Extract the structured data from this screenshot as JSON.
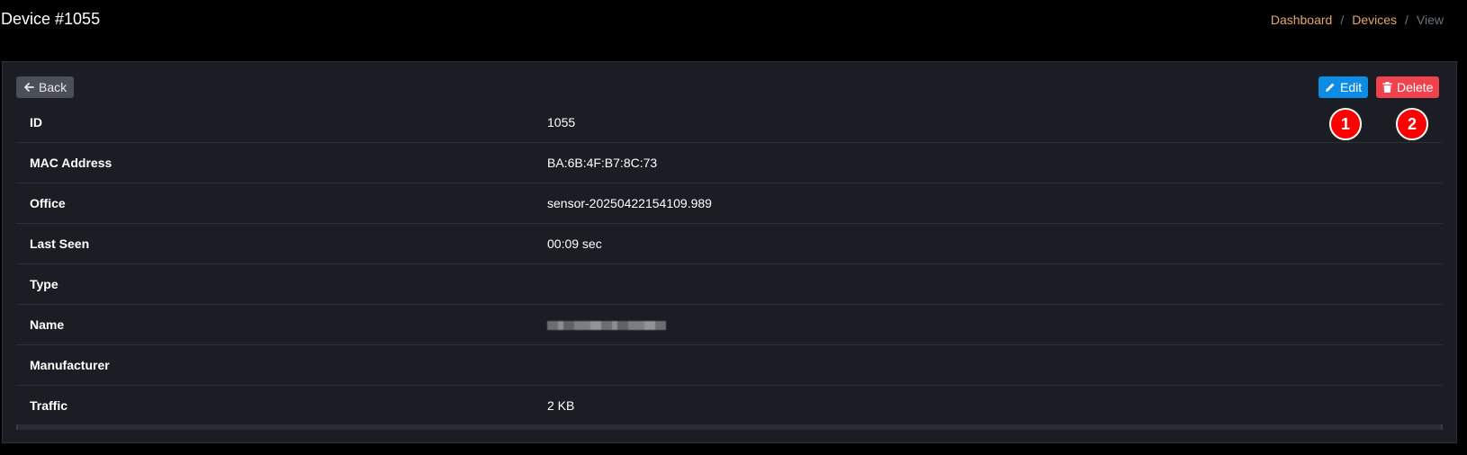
{
  "header": {
    "title": "Device #1055",
    "breadcrumb": {
      "dashboard": "Dashboard",
      "devices": "Devices",
      "current": "View",
      "separator": "/"
    }
  },
  "toolbar": {
    "back_label": "Back",
    "edit_label": "Edit",
    "delete_label": "Delete"
  },
  "markers": {
    "edit": "1",
    "delete": "2"
  },
  "details": {
    "rows": [
      {
        "label": "ID",
        "value": "1055"
      },
      {
        "label": "MAC Address",
        "value": "BA:6B:4F:B7:8C:73"
      },
      {
        "label": "Office",
        "value": "sensor-20250422154109.989"
      },
      {
        "label": "Last Seen",
        "value": "00:09 sec"
      },
      {
        "label": "Type",
        "value": ""
      },
      {
        "label": "Name",
        "value": ""
      },
      {
        "label": "Manufacturer",
        "value": ""
      },
      {
        "label": "Traffic",
        "value": "2 KB"
      }
    ]
  },
  "colors": {
    "breadcrumb_link": "#e2a86b",
    "edit_button": "#0d8ce6",
    "delete_button": "#f0424d",
    "card_background": "#1b1d24",
    "marker": "#ff0000"
  },
  "icons": {
    "back": "arrow-left-icon",
    "edit": "pencil-icon",
    "delete": "trash-icon"
  }
}
